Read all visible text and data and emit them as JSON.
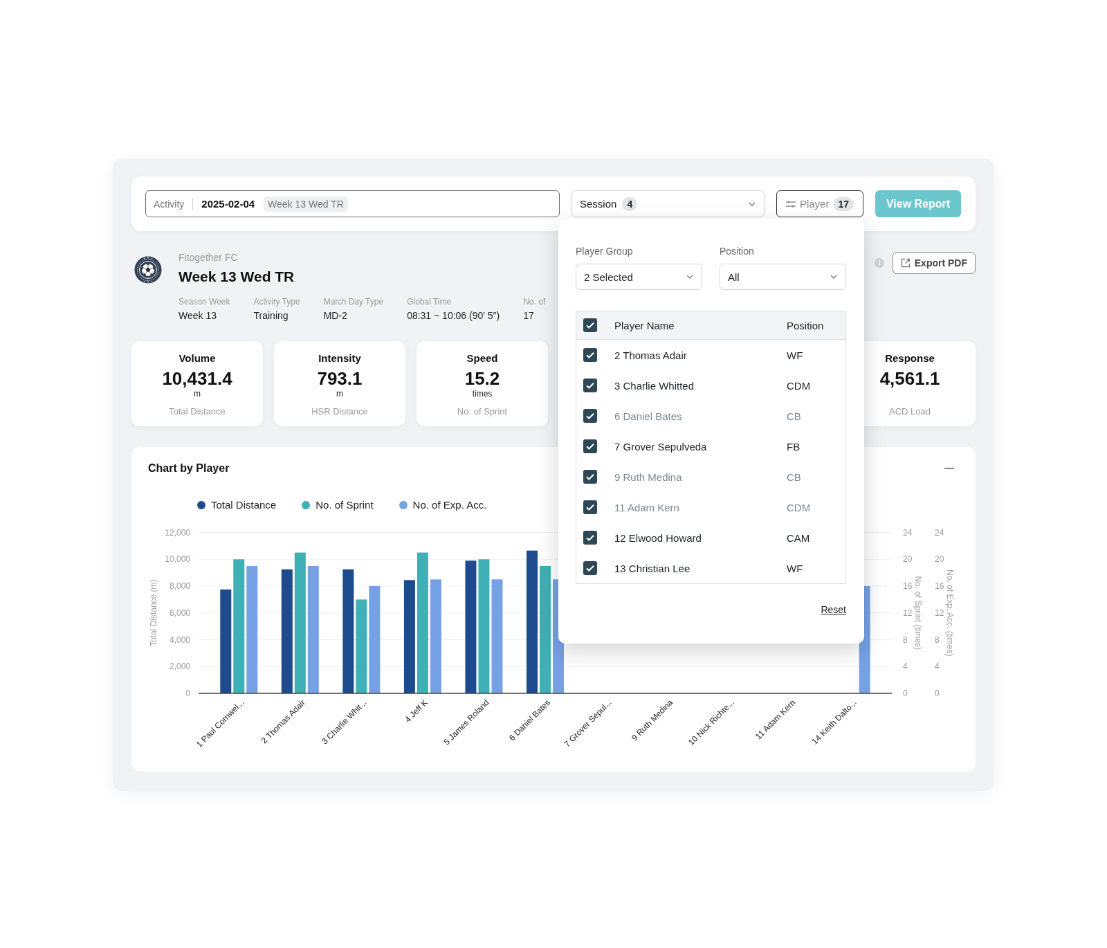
{
  "top_bar": {
    "activity_field": {
      "label": "Activity",
      "date": "2025-02-04",
      "tag": "Week 13 Wed TR"
    },
    "session_select": {
      "label": "Session",
      "count": "4"
    },
    "player_filter": {
      "label": "Player",
      "count": "17",
      "expanded": true
    },
    "view_report_button": "View Report"
  },
  "activity_header": {
    "club": "Fitogether FC",
    "title": "Week 13 Wed TR",
    "details": [
      {
        "label": "Season Week",
        "value": "Week 13"
      },
      {
        "label": "Activity Type",
        "value": "Training"
      },
      {
        "label": "Match Day Type",
        "value": "MD-2"
      },
      {
        "label": "Global Time",
        "value": "08:31 ~ 10:06 (90′ 5″)"
      },
      {
        "label": "No. of",
        "value": "17"
      }
    ],
    "export_button": "Export PDF"
  },
  "kpi_cards": [
    {
      "title": "Volume",
      "value": "10,431.4",
      "unit": "m",
      "metric": "Total Distance"
    },
    {
      "title": "Intensity",
      "value": "793.1",
      "unit": "m",
      "metric": "HSR Distance"
    },
    {
      "title": "Speed",
      "value": "15.2",
      "unit": "times",
      "metric": "No. of Sprint"
    },
    {
      "title": "Response",
      "value": "4,561.1",
      "metric": "ACD Load"
    }
  ],
  "chart_panel": {
    "title": "Chart by Player",
    "chart_data": {
      "type": "bar",
      "grid": true,
      "categories": [
        "1 Paul Cornwel...",
        "2 Thomas Adair",
        "3 Charlie Whit...",
        "4 Jeff K",
        "5 James Roland",
        "6 Daniel Bates",
        "7 Grover Sepul...",
        "9 Ruth Medina",
        "10 Nick Richte...",
        "11 Adam Kern",
        "14 Keith Dalto..."
      ],
      "ylabel": "Total Distance (m)",
      "ylim": [
        0,
        12000
      ],
      "yticks": [
        {
          "value": 0,
          "label": "0"
        },
        {
          "value": 2000,
          "label": "2,000"
        },
        {
          "value": 4000,
          "label": "4,000"
        },
        {
          "value": 6000,
          "label": "6,000"
        },
        {
          "value": 8000,
          "label": "8,000"
        },
        {
          "value": 10000,
          "label": "10,000"
        },
        {
          "value": 12000,
          "label": "12,000"
        }
      ],
      "y2label": "No. of Sprint (times)",
      "y2lim": [
        0,
        24
      ],
      "y2ticks": [
        0,
        4,
        8,
        12,
        16,
        20,
        24
      ],
      "y3label": "No. of Exp. Acc. (times)",
      "y3lim": [
        0,
        24
      ],
      "y3ticks": [
        0,
        4,
        8,
        12,
        16,
        20,
        24
      ],
      "series": [
        {
          "name": "Total Distance",
          "color": "#1e4a8e",
          "values": [
            7750,
            9250,
            9250,
            8450,
            9900,
            10650,
            null,
            null,
            null,
            null,
            null
          ]
        },
        {
          "name": "No. of Sprint",
          "color": "#3fb0b6",
          "axis": "y2",
          "values": [
            20,
            21,
            14,
            21,
            20,
            19,
            null,
            null,
            null,
            null,
            null
          ]
        },
        {
          "name": "No. of Exp. Acc.",
          "color": "#77a1e5",
          "axis": "y3",
          "values": [
            19,
            19,
            16,
            17,
            17,
            17,
            null,
            null,
            null,
            null,
            16
          ]
        }
      ]
    }
  },
  "player_dropdown": {
    "player_group": {
      "label": "Player Group",
      "value": "2 Selected"
    },
    "position": {
      "label": "Position",
      "value": "All"
    },
    "table": {
      "columns": [
        "Player Name",
        "Position"
      ],
      "all_checked": true,
      "rows": [
        {
          "name": "2 Thomas Adair",
          "position": "WF",
          "checked": true,
          "dimmed": false
        },
        {
          "name": "3 Charlie Whitted",
          "position": "CDM",
          "checked": true,
          "dimmed": false
        },
        {
          "name": "6 Daniel Bates",
          "position": "CB",
          "checked": true,
          "dimmed": true
        },
        {
          "name": "7 Grover Sepulveda",
          "position": "FB",
          "checked": true,
          "dimmed": false
        },
        {
          "name": "9 Ruth Medina",
          "position": "CB",
          "checked": true,
          "dimmed": true
        },
        {
          "name": "11 Adam Kern",
          "position": "CDM",
          "checked": true,
          "dimmed": true
        },
        {
          "name": "12 Elwood Howard",
          "position": "CAM",
          "checked": true,
          "dimmed": false
        },
        {
          "name": "13 Christian Lee",
          "position": "WF",
          "checked": true,
          "dimmed": false
        }
      ]
    },
    "reset_link": "Reset"
  }
}
